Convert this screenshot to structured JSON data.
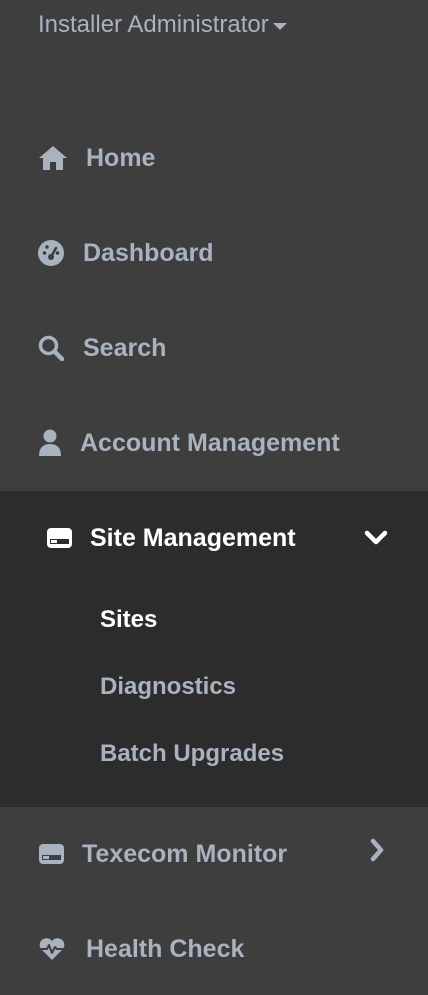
{
  "user_menu": {
    "label": "Installer Administrator",
    "caret_icon": "caret-down-icon"
  },
  "nav": {
    "home": {
      "label": "Home",
      "icon": "home-icon"
    },
    "dashboard": {
      "label": "Dashboard",
      "icon": "dashboard-icon"
    },
    "search": {
      "label": "Search",
      "icon": "search-icon"
    },
    "account_management": {
      "label": "Account Management",
      "icon": "user-icon"
    },
    "site_management": {
      "label": "Site Management",
      "icon": "hdd-icon",
      "expanded": true,
      "chevron": "chevron-down-icon",
      "children": [
        {
          "label": "Sites",
          "active": true
        },
        {
          "label": "Diagnostics",
          "active": false
        },
        {
          "label": "Batch Upgrades",
          "active": false
        }
      ]
    },
    "texecom_monitor": {
      "label": "Texecom Monitor",
      "icon": "hdd-icon",
      "chevron": "chevron-right-icon"
    },
    "health_check": {
      "label": "Health Check",
      "icon": "heartbeat-icon"
    }
  },
  "colors": {
    "background": "#3e3e3e",
    "expanded_background": "#2c2c2c",
    "text": "#a9b2bf",
    "active_text": "#ffffff"
  }
}
